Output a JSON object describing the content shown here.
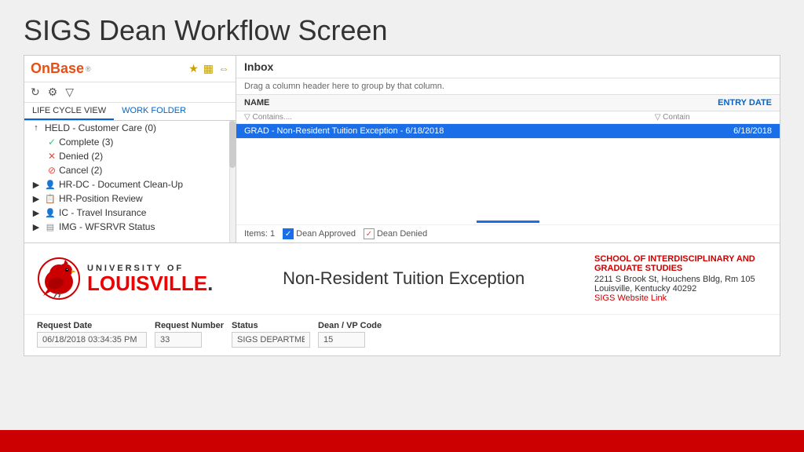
{
  "page": {
    "title": "SIGS Dean Workflow Screen"
  },
  "sidebar": {
    "logo": "OnBase",
    "logo_tm": "®",
    "tabs": [
      {
        "label": "LIFE CYCLE VIEW",
        "active": true
      },
      {
        "label": "WORK FOLDER",
        "active": false
      }
    ],
    "items": [
      {
        "label": "HELD - Customer Care (0)",
        "icon": "⬆",
        "type": "held"
      },
      {
        "label": "Complete (3)",
        "icon": "✓",
        "type": "complete"
      },
      {
        "label": "Denied (2)",
        "icon": "✕",
        "type": "denied"
      },
      {
        "label": "Cancel (2)",
        "icon": "⊘",
        "type": "cancel"
      },
      {
        "label": "HR-DC - Document Clean-Up",
        "icon": "⊞",
        "type": "group"
      },
      {
        "label": "HR-Position Review",
        "icon": "⊞",
        "type": "group"
      },
      {
        "label": "IC - Travel Insurance",
        "icon": "⊞",
        "type": "group"
      },
      {
        "label": "IMG - WFSRVR Status",
        "icon": "⊞",
        "type": "group"
      }
    ]
  },
  "inbox": {
    "title": "Inbox",
    "drag_hint": "Drag a column header here to group by that column.",
    "columns": [
      {
        "label": "NAME",
        "filter": "▽ Contains...."
      },
      {
        "label": "ENTRY DATE",
        "filter": "▽ Contain"
      }
    ],
    "rows": [
      {
        "name": "GRAD - Non-Resident Tuition Exception - 6/18/2018",
        "entry_date": "6/18/2018",
        "selected": true
      }
    ],
    "items_count": "Items: 1",
    "legend": [
      {
        "icon": "✓",
        "type": "blue",
        "label": "Dean Approved"
      },
      {
        "icon": "✓",
        "type": "red",
        "label": "Dean Denied"
      }
    ]
  },
  "university_form": {
    "univ_of": "UNIVERSITY OF",
    "univ_name": "LOUISVILLE",
    "univ_dot": ".",
    "form_title": "Non-Resident Tuition Exception",
    "contact": {
      "dept": "SCHOOL OF INTERDISCIPLINARY AND GRADUATE STUDIES",
      "address1": "2211 S Brook St, Houchens Bldg, Rm 105",
      "address2": "Louisville, Kentucky 40292",
      "website": "SIGS Website Link"
    },
    "fields": [
      {
        "label": "Request Date",
        "value": "06/18/2018 03:34:35 PM",
        "size": "large"
      },
      {
        "label": "Request Number",
        "value": "33",
        "size": "small"
      },
      {
        "label": "Status",
        "value": "SIGS DEPARTMENT",
        "size": "medium"
      },
      {
        "label": "Dean / VP Code",
        "value": "15",
        "size": "small"
      }
    ]
  }
}
